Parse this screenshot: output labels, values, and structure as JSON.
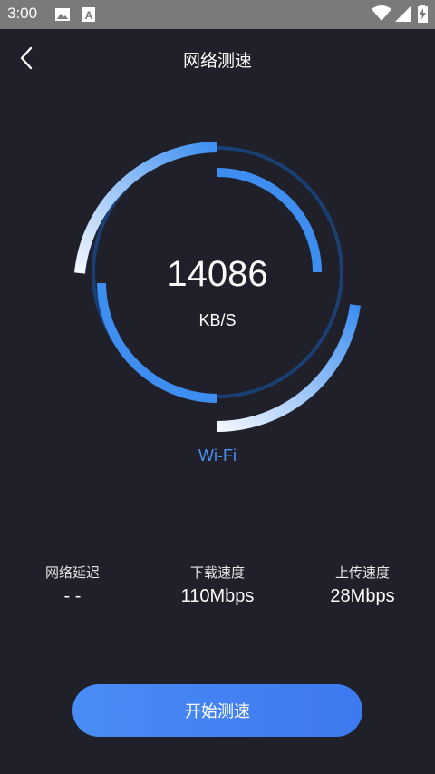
{
  "status_bar": {
    "time": "3:00",
    "icons": [
      "image-icon",
      "a-icon",
      "wifi-icon",
      "signal-icon",
      "battery-charging-icon"
    ]
  },
  "header": {
    "title": "网络测速",
    "back_icon": "chevron-left-icon"
  },
  "gauge": {
    "speed_value": "14086",
    "speed_unit": "KB/S",
    "network_type": "Wi-Fi",
    "colors": {
      "arc_light": "#e8f1ff",
      "arc_blue": "#3d8ef0",
      "ring_dark": "#1a3f73"
    }
  },
  "stats": [
    {
      "label": "网络延迟",
      "value": "- -"
    },
    {
      "label": "下载速度",
      "value": "110Mbps"
    },
    {
      "label": "上传速度",
      "value": "28Mbps"
    }
  ],
  "start_button": {
    "label": "开始测速"
  },
  "colors": {
    "background": "#1f2029",
    "accent": "#4a8cf5",
    "wifi_text": "#4a90f0"
  }
}
